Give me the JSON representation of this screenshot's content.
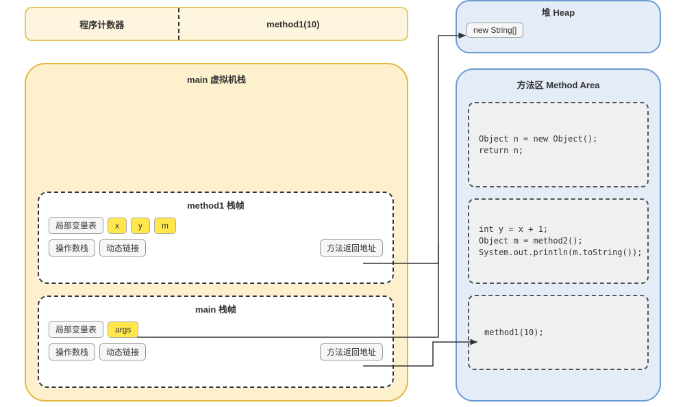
{
  "program_counter": {
    "label": "程序计数器",
    "value": "method1(10)"
  },
  "heap": {
    "title": "堆 Heap",
    "object": "new String[]"
  },
  "vm_stack": {
    "title": "main 虚拟机栈",
    "frames": [
      {
        "title": "method1 栈帧",
        "local_var_label": "局部变量表",
        "vars": [
          "x",
          "y",
          "m"
        ],
        "op_stack": "操作数栈",
        "dyn_link": "动态链接",
        "return_addr": "方法返回地址"
      },
      {
        "title": "main 栈帧",
        "local_var_label": "局部变量表",
        "vars": [
          "args"
        ],
        "op_stack": "操作数栈",
        "dyn_link": "动态链接",
        "return_addr": "方法返回地址"
      }
    ]
  },
  "method_area": {
    "title": "方法区 Method Area",
    "blocks": [
      "Object n = new Object();\nreturn n;",
      "int y = x + 1;\nObject m = method2();\nSystem.out.println(m.toString());",
      "method1(10);"
    ]
  }
}
